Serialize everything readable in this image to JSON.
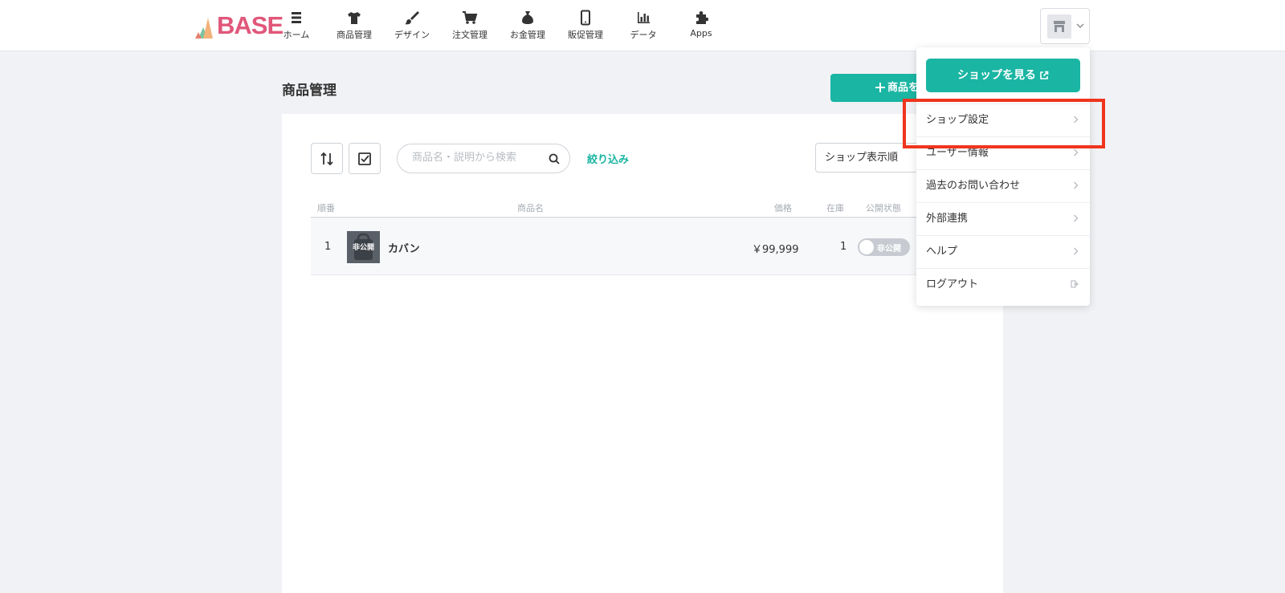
{
  "brand": {
    "logo_text": "BASE",
    "accent": "#1ab5a3",
    "logo_color": "#e0577a"
  },
  "nav": [
    {
      "label": "ホーム",
      "icon": "list-icon"
    },
    {
      "label": "商品管理",
      "icon": "tshirt-icon"
    },
    {
      "label": "デザイン",
      "icon": "brush-icon"
    },
    {
      "label": "注文管理",
      "icon": "cart-icon"
    },
    {
      "label": "お金管理",
      "icon": "money-bag-icon"
    },
    {
      "label": "販促管理",
      "icon": "smartphone-icon"
    },
    {
      "label": "データ",
      "icon": "bar-chart-icon"
    },
    {
      "label": "Apps",
      "icon": "puzzle-icon"
    }
  ],
  "page": {
    "title": "商品管理",
    "add_button": "商品を"
  },
  "toolbar": {
    "search_placeholder": "商品名・説明から検索",
    "filter_label": "絞り込み",
    "sort_value": "ショップ表示順"
  },
  "table": {
    "headers": [
      "順番",
      "商品名",
      "価格",
      "在庫",
      "公開状態"
    ],
    "rows": [
      {
        "order": "1",
        "thumb_label": "非公開",
        "name": "カバン",
        "price": "￥99,999",
        "stock": "1",
        "status": "非公開"
      }
    ]
  },
  "dropdown": {
    "view_shop": "ショップを見る",
    "items": [
      {
        "label": "ショップ設定",
        "icon": "chevron-right-icon"
      },
      {
        "label": "ユーザー情報",
        "icon": "chevron-right-icon"
      },
      {
        "label": "過去のお問い合わせ",
        "icon": "chevron-right-icon"
      },
      {
        "label": "外部連携",
        "icon": "chevron-right-icon"
      },
      {
        "label": "ヘルプ",
        "icon": "chevron-right-icon"
      },
      {
        "label": "ログアウト",
        "icon": "logout-icon"
      }
    ]
  },
  "highlight_color": "#f0351e"
}
